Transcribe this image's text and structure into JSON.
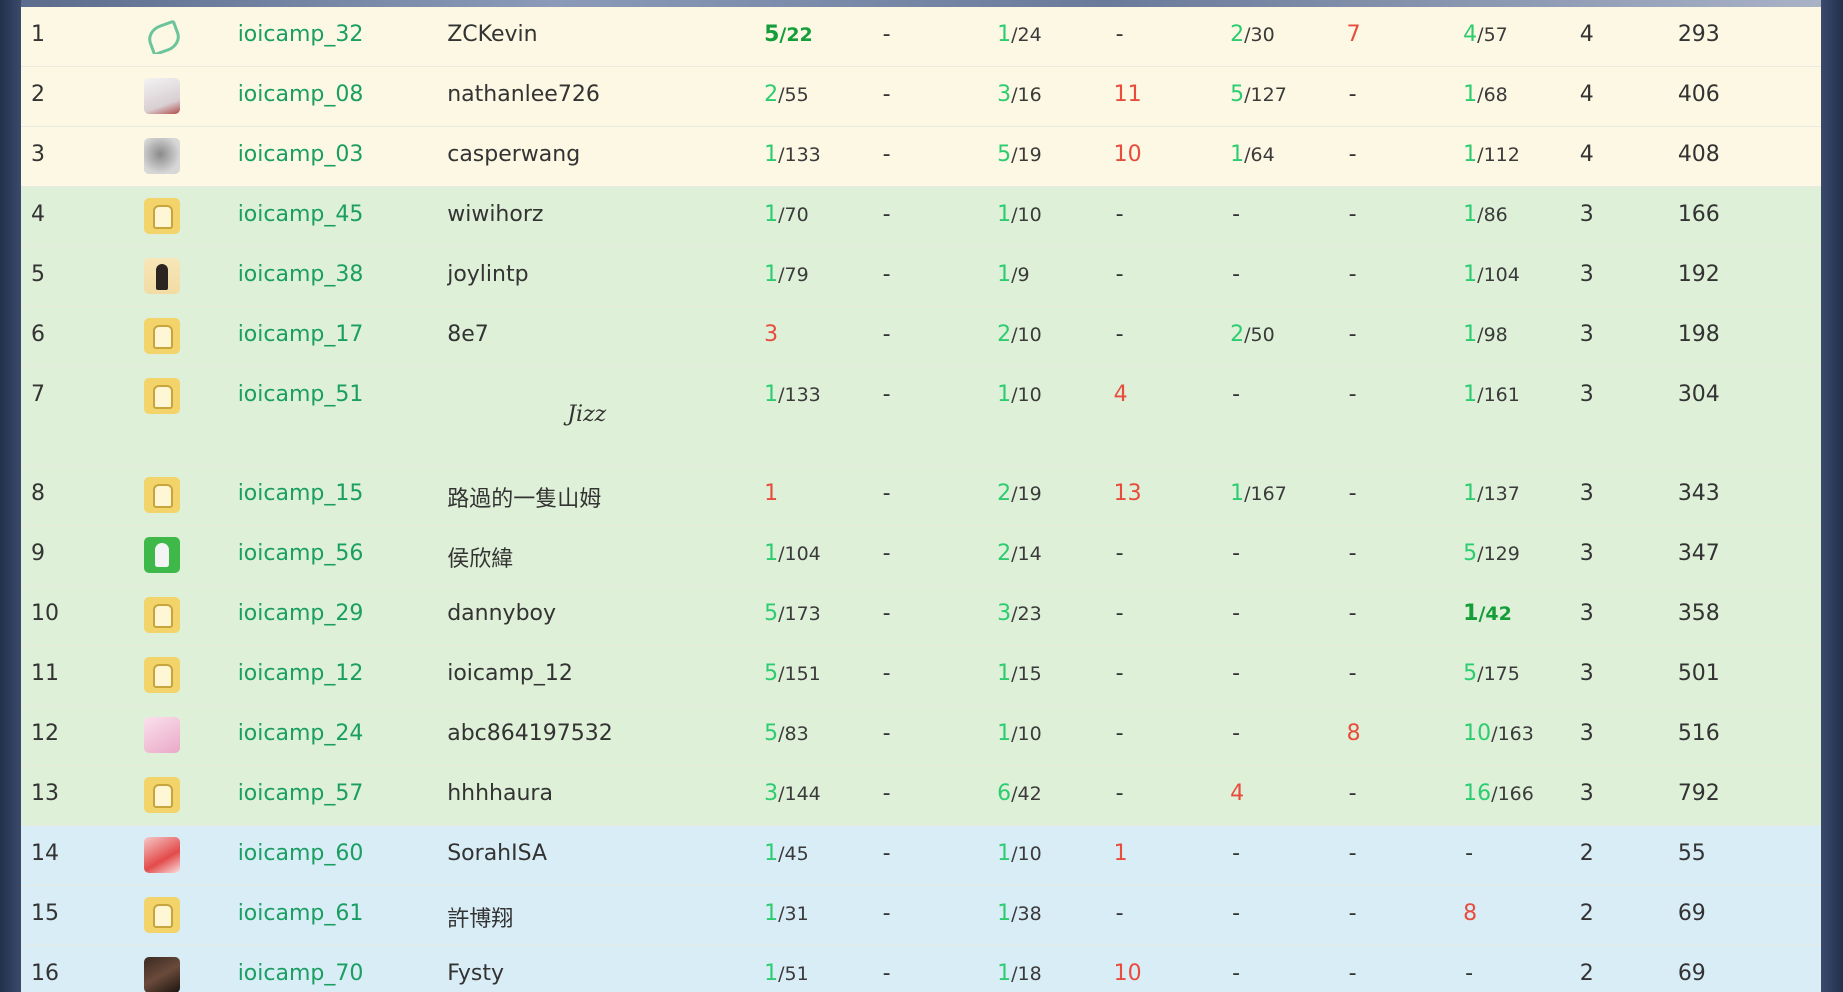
{
  "rows": [
    {
      "rank": "1",
      "avatar": "logo",
      "account": "ioicamp_32",
      "name": "ZCKevin",
      "problems": [
        {
          "t": "5",
          "s": "/22",
          "first": true
        },
        {
          "d": "-"
        },
        {
          "t": "1",
          "s": "/24"
        },
        {
          "d": "-"
        },
        {
          "t": "2",
          "s": "/30"
        },
        {
          "f": "7"
        },
        {
          "t": "4",
          "s": "/57"
        }
      ],
      "solved": "4",
      "penalty": "293",
      "tone": "gold"
    },
    {
      "rank": "2",
      "avatar": "white",
      "account": "ioicamp_08",
      "name": "nathanlee726",
      "problems": [
        {
          "t": "2",
          "s": "/55"
        },
        {
          "d": "-"
        },
        {
          "t": "3",
          "s": "/16"
        },
        {
          "f": "11"
        },
        {
          "t": "5",
          "s": "/127"
        },
        {
          "d": "-"
        },
        {
          "t": "1",
          "s": "/68"
        }
      ],
      "solved": "4",
      "penalty": "406",
      "tone": "gold"
    },
    {
      "rank": "3",
      "avatar": "gray",
      "account": "ioicamp_03",
      "name": "casperwang",
      "problems": [
        {
          "t": "1",
          "s": "/133"
        },
        {
          "d": "-"
        },
        {
          "t": "5",
          "s": "/19"
        },
        {
          "f": "10"
        },
        {
          "t": "1",
          "s": "/64"
        },
        {
          "d": "-"
        },
        {
          "t": "1",
          "s": "/112"
        }
      ],
      "solved": "4",
      "penalty": "408",
      "tone": "gold"
    },
    {
      "rank": "4",
      "avatar": "yellow",
      "account": "ioicamp_45",
      "name": "wiwihorz",
      "problems": [
        {
          "t": "1",
          "s": "/70"
        },
        {
          "d": "-"
        },
        {
          "t": "1",
          "s": "/10"
        },
        {
          "d": "-"
        },
        {
          "d": "-"
        },
        {
          "d": "-"
        },
        {
          "t": "1",
          "s": "/86"
        }
      ],
      "solved": "3",
      "penalty": "166",
      "tone": "green"
    },
    {
      "rank": "5",
      "avatar": "dark",
      "account": "ioicamp_38",
      "name": "joylintp",
      "problems": [
        {
          "t": "1",
          "s": "/79"
        },
        {
          "d": "-"
        },
        {
          "t": "1",
          "s": "/9"
        },
        {
          "d": "-"
        },
        {
          "d": "-"
        },
        {
          "d": "-"
        },
        {
          "t": "1",
          "s": "/104"
        }
      ],
      "solved": "3",
      "penalty": "192",
      "tone": "green"
    },
    {
      "rank": "6",
      "avatar": "yellow",
      "account": "ioicamp_17",
      "name": "8e7",
      "problems": [
        {
          "f": "3"
        },
        {
          "d": "-"
        },
        {
          "t": "2",
          "s": "/10"
        },
        {
          "d": "-"
        },
        {
          "t": "2",
          "s": "/50"
        },
        {
          "d": "-"
        },
        {
          "t": "1",
          "s": "/98"
        }
      ],
      "solved": "3",
      "penalty": "198",
      "tone": "green"
    },
    {
      "rank": "7",
      "avatar": "yellow",
      "account": "ioicamp_51",
      "name": "Jizz",
      "fancy": true,
      "problems": [
        {
          "t": "1",
          "s": "/133"
        },
        {
          "d": "-"
        },
        {
          "t": "1",
          "s": "/10"
        },
        {
          "f": "4"
        },
        {
          "d": "-"
        },
        {
          "d": "-"
        },
        {
          "t": "1",
          "s": "/161"
        }
      ],
      "solved": "3",
      "penalty": "304",
      "tone": "green"
    },
    {
      "rank": "8",
      "avatar": "yellow",
      "account": "ioicamp_15",
      "name": "路過的一隻山姆",
      "problems": [
        {
          "f": "1"
        },
        {
          "d": "-"
        },
        {
          "t": "2",
          "s": "/19"
        },
        {
          "f": "13"
        },
        {
          "t": "1",
          "s": "/167"
        },
        {
          "d": "-"
        },
        {
          "t": "1",
          "s": "/137"
        }
      ],
      "solved": "3",
      "penalty": "343",
      "tone": "green"
    },
    {
      "rank": "9",
      "avatar": "green",
      "account": "ioicamp_56",
      "name": "侯欣緯",
      "problems": [
        {
          "t": "1",
          "s": "/104"
        },
        {
          "d": "-"
        },
        {
          "t": "2",
          "s": "/14"
        },
        {
          "d": "-"
        },
        {
          "d": "-"
        },
        {
          "d": "-"
        },
        {
          "t": "5",
          "s": "/129"
        }
      ],
      "solved": "3",
      "penalty": "347",
      "tone": "green"
    },
    {
      "rank": "10",
      "avatar": "yellow",
      "account": "ioicamp_29",
      "name": "dannyboy",
      "problems": [
        {
          "t": "5",
          "s": "/173"
        },
        {
          "d": "-"
        },
        {
          "t": "3",
          "s": "/23"
        },
        {
          "d": "-"
        },
        {
          "d": "-"
        },
        {
          "d": "-"
        },
        {
          "t": "1",
          "s": "/42",
          "first": true
        }
      ],
      "solved": "3",
      "penalty": "358",
      "tone": "green"
    },
    {
      "rank": "11",
      "avatar": "yellow",
      "account": "ioicamp_12",
      "name": "ioicamp_12",
      "problems": [
        {
          "t": "5",
          "s": "/151"
        },
        {
          "d": "-"
        },
        {
          "t": "1",
          "s": "/15"
        },
        {
          "d": "-"
        },
        {
          "d": "-"
        },
        {
          "d": "-"
        },
        {
          "t": "5",
          "s": "/175"
        }
      ],
      "solved": "3",
      "penalty": "501",
      "tone": "green"
    },
    {
      "rank": "12",
      "avatar": "pink",
      "account": "ioicamp_24",
      "name": "abc864197532",
      "problems": [
        {
          "t": "5",
          "s": "/83"
        },
        {
          "d": "-"
        },
        {
          "t": "1",
          "s": "/10"
        },
        {
          "d": "-"
        },
        {
          "d": "-"
        },
        {
          "f": "8"
        },
        {
          "t": "10",
          "s": "/163"
        }
      ],
      "solved": "3",
      "penalty": "516",
      "tone": "green"
    },
    {
      "rank": "13",
      "avatar": "yellow",
      "account": "ioicamp_57",
      "name": "hhhhaura",
      "problems": [
        {
          "t": "3",
          "s": "/144"
        },
        {
          "d": "-"
        },
        {
          "t": "6",
          "s": "/42"
        },
        {
          "d": "-"
        },
        {
          "f": "4"
        },
        {
          "d": "-"
        },
        {
          "t": "16",
          "s": "/166"
        }
      ],
      "solved": "3",
      "penalty": "792",
      "tone": "green"
    },
    {
      "rank": "14",
      "avatar": "red",
      "account": "ioicamp_60",
      "name": "SorahISA",
      "problems": [
        {
          "t": "1",
          "s": "/45"
        },
        {
          "d": "-"
        },
        {
          "t": "1",
          "s": "/10"
        },
        {
          "f": "1"
        },
        {
          "d": "-"
        },
        {
          "d": "-"
        },
        {
          "d": "-"
        }
      ],
      "solved": "2",
      "penalty": "55",
      "tone": "blue"
    },
    {
      "rank": "15",
      "avatar": "yellow",
      "account": "ioicamp_61",
      "name": "許博翔",
      "problems": [
        {
          "t": "1",
          "s": "/31"
        },
        {
          "d": "-"
        },
        {
          "t": "1",
          "s": "/38"
        },
        {
          "d": "-"
        },
        {
          "d": "-"
        },
        {
          "d": "-"
        },
        {
          "f": "8"
        }
      ],
      "solved": "2",
      "penalty": "69",
      "tone": "blue"
    },
    {
      "rank": "16",
      "avatar": "night",
      "account": "ioicamp_70",
      "name": "Fysty",
      "problems": [
        {
          "t": "1",
          "s": "/51"
        },
        {
          "d": "-"
        },
        {
          "t": "1",
          "s": "/18"
        },
        {
          "f": "10"
        },
        {
          "d": "-"
        },
        {
          "d": "-"
        },
        {
          "d": "-"
        }
      ],
      "solved": "2",
      "penalty": "69",
      "tone": "blue"
    }
  ]
}
